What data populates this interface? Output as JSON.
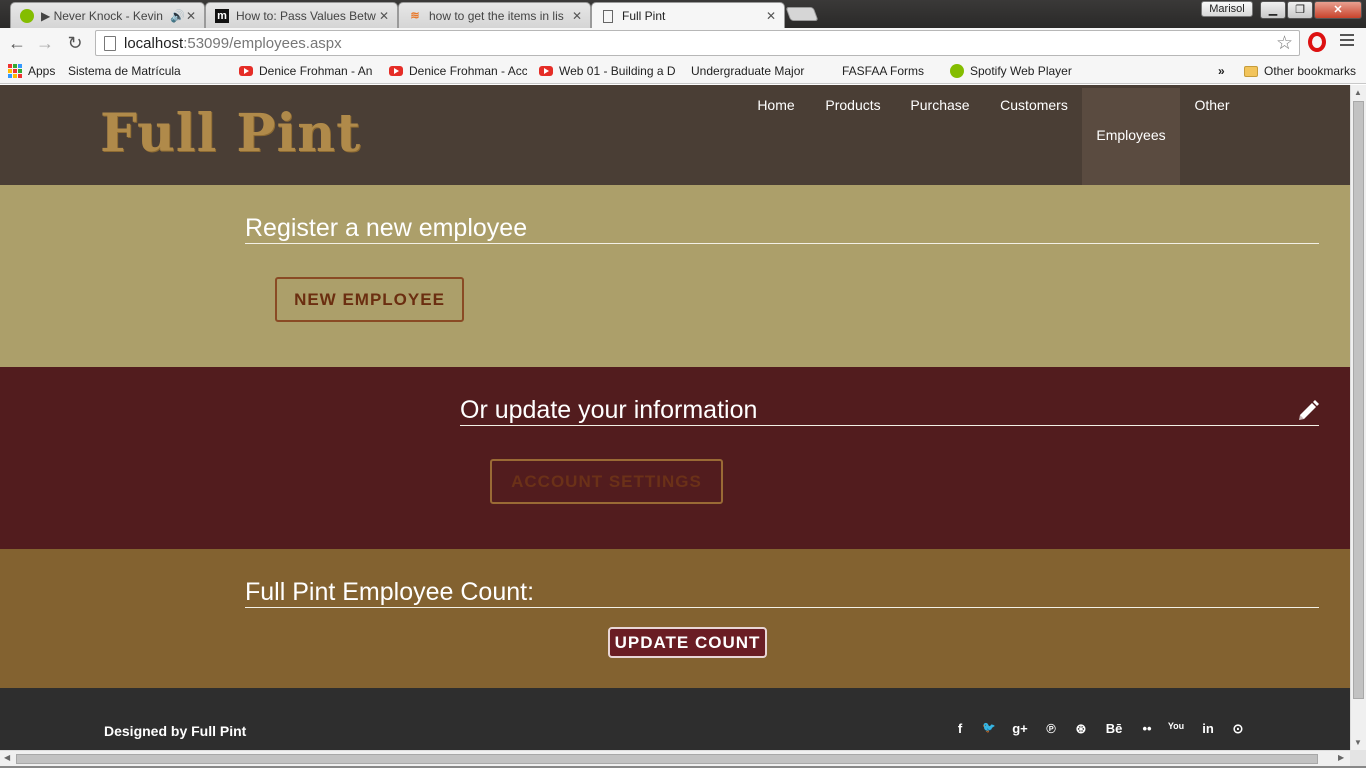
{
  "browser": {
    "tabs": [
      {
        "title": "▶ Never Knock - Kevin",
        "favicon": "spotify-icon",
        "audio": true
      },
      {
        "title": "How to: Pass Values Betw",
        "favicon": "m-icon"
      },
      {
        "title": "how to get the items in lis",
        "favicon": "stackoverflow-icon"
      },
      {
        "title": "Full Pint",
        "favicon": "page-icon",
        "active": true
      }
    ],
    "profile_name": "Marisol",
    "url_host": "localhost",
    "url_path": ":53099/employees.aspx",
    "bookmarks": [
      {
        "label": "Apps",
        "icon": "apps-grid-icon"
      },
      {
        "label": "Sistema de Matrícula",
        "icon": "page-icon"
      },
      {
        "label": "",
        "icon": "page-icon"
      },
      {
        "label": "Denice Frohman - An",
        "icon": "youtube-icon"
      },
      {
        "label": "Denice Frohman - Acc",
        "icon": "youtube-icon"
      },
      {
        "label": "Web 01 - Building a D",
        "icon": "youtube-icon"
      },
      {
        "label": "Undergraduate Major",
        "icon": "page-icon"
      },
      {
        "label": "FASFAA Forms",
        "icon": "page-icon"
      },
      {
        "label": "Spotify Web Player",
        "icon": "spotify-icon"
      }
    ],
    "overflow_label": "»",
    "other_bookmarks": "Other bookmarks"
  },
  "site": {
    "logo": "Full Pint",
    "nav": [
      "Home",
      "Products",
      "Purchase",
      "Customers",
      "Employees",
      "Other"
    ],
    "active_nav": "Employees"
  },
  "register": {
    "title": "Register a new employee",
    "button": "NEW EMPLOYEE"
  },
  "update": {
    "title": "Or update your information",
    "button": "ACCOUNT SETTINGS",
    "icon": "pencil-icon"
  },
  "count": {
    "title": "Full Pint Employee Count:",
    "button": "UPDATE COUNT"
  },
  "footer": {
    "credit": "Designed by Full Pint",
    "social": [
      {
        "name": "facebook-icon",
        "glyph": "f"
      },
      {
        "name": "twitter-icon",
        "glyph": "🐦"
      },
      {
        "name": "google-plus-icon",
        "glyph": "g+"
      },
      {
        "name": "pinterest-icon",
        "glyph": "℗"
      },
      {
        "name": "dribbble-icon",
        "glyph": "⊛"
      },
      {
        "name": "behance-icon",
        "glyph": "Bē"
      },
      {
        "name": "flickr-icon",
        "glyph": "••"
      },
      {
        "name": "youtube-icon",
        "glyph": "You"
      },
      {
        "name": "linkedin-icon",
        "glyph": "in"
      },
      {
        "name": "github-icon",
        "glyph": "⊙"
      }
    ]
  },
  "colors": {
    "header": "#4a3e35",
    "section_register": "#ac9f6a",
    "section_update": "#521c1e",
    "section_count": "#836230",
    "footer": "#2e2e2e"
  }
}
